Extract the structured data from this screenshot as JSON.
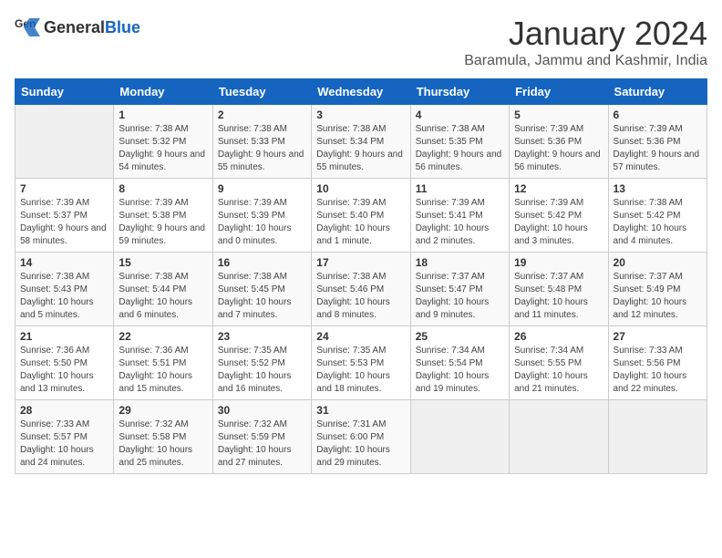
{
  "header": {
    "logo_general": "General",
    "logo_blue": "Blue",
    "month_title": "January 2024",
    "location": "Baramula, Jammu and Kashmir, India"
  },
  "days_of_week": [
    "Sunday",
    "Monday",
    "Tuesday",
    "Wednesday",
    "Thursday",
    "Friday",
    "Saturday"
  ],
  "weeks": [
    [
      {
        "day": "",
        "sunrise": "",
        "sunset": "",
        "daylight": ""
      },
      {
        "day": "1",
        "sunrise": "Sunrise: 7:38 AM",
        "sunset": "Sunset: 5:32 PM",
        "daylight": "Daylight: 9 hours and 54 minutes."
      },
      {
        "day": "2",
        "sunrise": "Sunrise: 7:38 AM",
        "sunset": "Sunset: 5:33 PM",
        "daylight": "Daylight: 9 hours and 55 minutes."
      },
      {
        "day": "3",
        "sunrise": "Sunrise: 7:38 AM",
        "sunset": "Sunset: 5:34 PM",
        "daylight": "Daylight: 9 hours and 55 minutes."
      },
      {
        "day": "4",
        "sunrise": "Sunrise: 7:38 AM",
        "sunset": "Sunset: 5:35 PM",
        "daylight": "Daylight: 9 hours and 56 minutes."
      },
      {
        "day": "5",
        "sunrise": "Sunrise: 7:39 AM",
        "sunset": "Sunset: 5:36 PM",
        "daylight": "Daylight: 9 hours and 56 minutes."
      },
      {
        "day": "6",
        "sunrise": "Sunrise: 7:39 AM",
        "sunset": "Sunset: 5:36 PM",
        "daylight": "Daylight: 9 hours and 57 minutes."
      }
    ],
    [
      {
        "day": "7",
        "sunrise": "Sunrise: 7:39 AM",
        "sunset": "Sunset: 5:37 PM",
        "daylight": "Daylight: 9 hours and 58 minutes."
      },
      {
        "day": "8",
        "sunrise": "Sunrise: 7:39 AM",
        "sunset": "Sunset: 5:38 PM",
        "daylight": "Daylight: 9 hours and 59 minutes."
      },
      {
        "day": "9",
        "sunrise": "Sunrise: 7:39 AM",
        "sunset": "Sunset: 5:39 PM",
        "daylight": "Daylight: 10 hours and 0 minutes."
      },
      {
        "day": "10",
        "sunrise": "Sunrise: 7:39 AM",
        "sunset": "Sunset: 5:40 PM",
        "daylight": "Daylight: 10 hours and 1 minute."
      },
      {
        "day": "11",
        "sunrise": "Sunrise: 7:39 AM",
        "sunset": "Sunset: 5:41 PM",
        "daylight": "Daylight: 10 hours and 2 minutes."
      },
      {
        "day": "12",
        "sunrise": "Sunrise: 7:39 AM",
        "sunset": "Sunset: 5:42 PM",
        "daylight": "Daylight: 10 hours and 3 minutes."
      },
      {
        "day": "13",
        "sunrise": "Sunrise: 7:38 AM",
        "sunset": "Sunset: 5:42 PM",
        "daylight": "Daylight: 10 hours and 4 minutes."
      }
    ],
    [
      {
        "day": "14",
        "sunrise": "Sunrise: 7:38 AM",
        "sunset": "Sunset: 5:43 PM",
        "daylight": "Daylight: 10 hours and 5 minutes."
      },
      {
        "day": "15",
        "sunrise": "Sunrise: 7:38 AM",
        "sunset": "Sunset: 5:44 PM",
        "daylight": "Daylight: 10 hours and 6 minutes."
      },
      {
        "day": "16",
        "sunrise": "Sunrise: 7:38 AM",
        "sunset": "Sunset: 5:45 PM",
        "daylight": "Daylight: 10 hours and 7 minutes."
      },
      {
        "day": "17",
        "sunrise": "Sunrise: 7:38 AM",
        "sunset": "Sunset: 5:46 PM",
        "daylight": "Daylight: 10 hours and 8 minutes."
      },
      {
        "day": "18",
        "sunrise": "Sunrise: 7:37 AM",
        "sunset": "Sunset: 5:47 PM",
        "daylight": "Daylight: 10 hours and 9 minutes."
      },
      {
        "day": "19",
        "sunrise": "Sunrise: 7:37 AM",
        "sunset": "Sunset: 5:48 PM",
        "daylight": "Daylight: 10 hours and 11 minutes."
      },
      {
        "day": "20",
        "sunrise": "Sunrise: 7:37 AM",
        "sunset": "Sunset: 5:49 PM",
        "daylight": "Daylight: 10 hours and 12 minutes."
      }
    ],
    [
      {
        "day": "21",
        "sunrise": "Sunrise: 7:36 AM",
        "sunset": "Sunset: 5:50 PM",
        "daylight": "Daylight: 10 hours and 13 minutes."
      },
      {
        "day": "22",
        "sunrise": "Sunrise: 7:36 AM",
        "sunset": "Sunset: 5:51 PM",
        "daylight": "Daylight: 10 hours and 15 minutes."
      },
      {
        "day": "23",
        "sunrise": "Sunrise: 7:35 AM",
        "sunset": "Sunset: 5:52 PM",
        "daylight": "Daylight: 10 hours and 16 minutes."
      },
      {
        "day": "24",
        "sunrise": "Sunrise: 7:35 AM",
        "sunset": "Sunset: 5:53 PM",
        "daylight": "Daylight: 10 hours and 18 minutes."
      },
      {
        "day": "25",
        "sunrise": "Sunrise: 7:34 AM",
        "sunset": "Sunset: 5:54 PM",
        "daylight": "Daylight: 10 hours and 19 minutes."
      },
      {
        "day": "26",
        "sunrise": "Sunrise: 7:34 AM",
        "sunset": "Sunset: 5:55 PM",
        "daylight": "Daylight: 10 hours and 21 minutes."
      },
      {
        "day": "27",
        "sunrise": "Sunrise: 7:33 AM",
        "sunset": "Sunset: 5:56 PM",
        "daylight": "Daylight: 10 hours and 22 minutes."
      }
    ],
    [
      {
        "day": "28",
        "sunrise": "Sunrise: 7:33 AM",
        "sunset": "Sunset: 5:57 PM",
        "daylight": "Daylight: 10 hours and 24 minutes."
      },
      {
        "day": "29",
        "sunrise": "Sunrise: 7:32 AM",
        "sunset": "Sunset: 5:58 PM",
        "daylight": "Daylight: 10 hours and 25 minutes."
      },
      {
        "day": "30",
        "sunrise": "Sunrise: 7:32 AM",
        "sunset": "Sunset: 5:59 PM",
        "daylight": "Daylight: 10 hours and 27 minutes."
      },
      {
        "day": "31",
        "sunrise": "Sunrise: 7:31 AM",
        "sunset": "Sunset: 6:00 PM",
        "daylight": "Daylight: 10 hours and 29 minutes."
      },
      {
        "day": "",
        "sunrise": "",
        "sunset": "",
        "daylight": ""
      },
      {
        "day": "",
        "sunrise": "",
        "sunset": "",
        "daylight": ""
      },
      {
        "day": "",
        "sunrise": "",
        "sunset": "",
        "daylight": ""
      }
    ]
  ]
}
